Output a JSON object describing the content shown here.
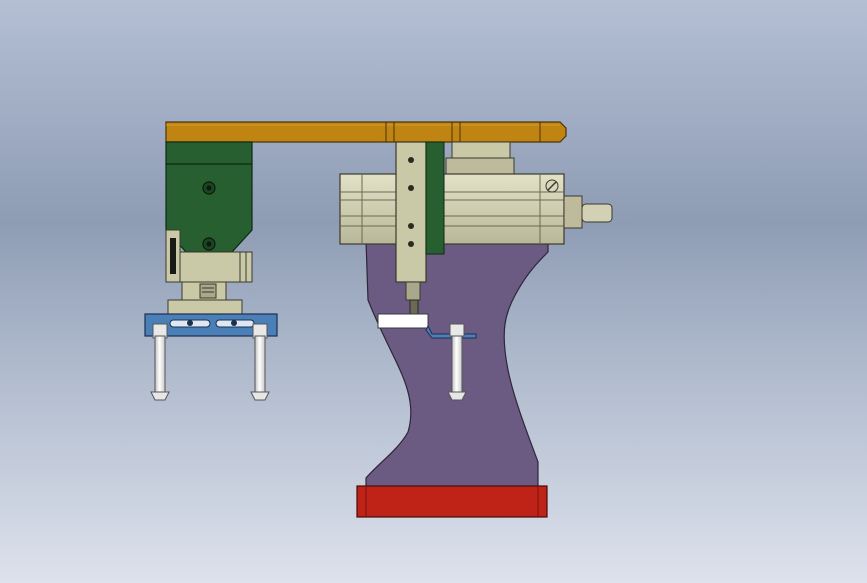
{
  "scene": {
    "type": "cad-assembly-view",
    "parts": [
      {
        "name": "top-beam",
        "color": "#c08412"
      },
      {
        "name": "gripper-body",
        "color": "#275f31"
      },
      {
        "name": "gripper-jaw-plate",
        "color": "#4a7fb8"
      },
      {
        "name": "pedestal",
        "color": "#6b5a82"
      },
      {
        "name": "base-plate",
        "color": "#bf2216"
      },
      {
        "name": "cylinder",
        "color": "#c9c8a7"
      },
      {
        "name": "bolts",
        "color": "#f2f2f2"
      },
      {
        "name": "white-bracket",
        "color": "#ffffff"
      }
    ]
  }
}
